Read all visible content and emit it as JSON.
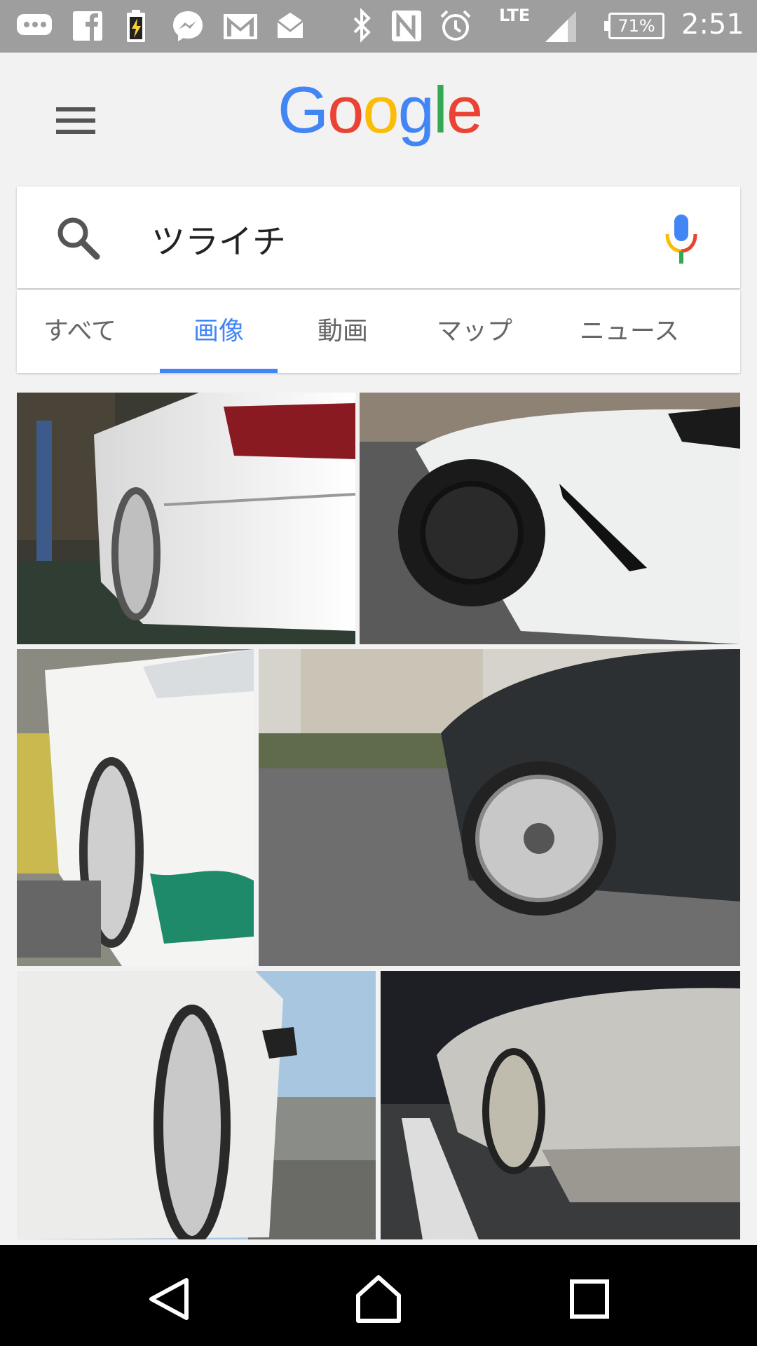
{
  "status_bar": {
    "battery_percent": "71%",
    "network": "LTE",
    "time": "2:51",
    "icons": [
      "chat-bubble-icon",
      "facebook-icon",
      "battery-saver-icon",
      "messenger-icon",
      "gmail-icon",
      "mail-icon",
      "bluetooth-icon",
      "nfc-icon",
      "alarm-icon",
      "signal-icon",
      "battery-icon"
    ]
  },
  "header": {
    "logo_letters": [
      {
        "char": "G",
        "color": "#4285f4"
      },
      {
        "char": "o",
        "color": "#ea4335"
      },
      {
        "char": "o",
        "color": "#fbbc05"
      },
      {
        "char": "g",
        "color": "#4285f4"
      },
      {
        "char": "l",
        "color": "#34a853"
      },
      {
        "char": "e",
        "color": "#ea4335"
      }
    ]
  },
  "search": {
    "query": "ツライチ"
  },
  "tabs": [
    {
      "label": "すべて",
      "active": false
    },
    {
      "label": "画像",
      "active": true
    },
    {
      "label": "動画",
      "active": false
    },
    {
      "label": "マップ",
      "active": false
    },
    {
      "label": "ニュース",
      "active": false
    }
  ],
  "colors": {
    "accent": "#4285f4",
    "status_bar": "#9e9e9e",
    "nav_bar": "#000000"
  }
}
